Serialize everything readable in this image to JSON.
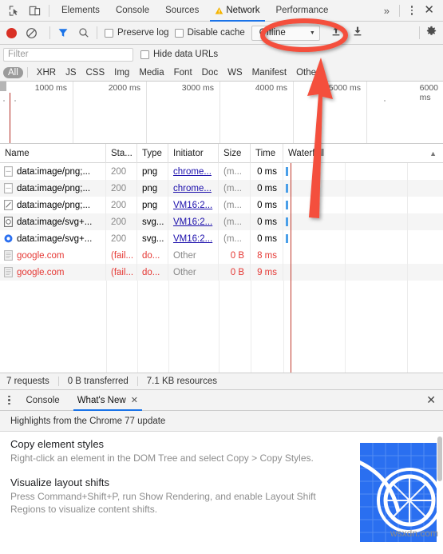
{
  "window": {
    "tabs": [
      {
        "label": "Elements",
        "active": false,
        "warning": false
      },
      {
        "label": "Console",
        "active": false,
        "warning": false
      },
      {
        "label": "Sources",
        "active": false,
        "warning": false
      },
      {
        "label": "Network",
        "active": true,
        "warning": true
      },
      {
        "label": "Performance",
        "active": false,
        "warning": false
      }
    ],
    "more_label": "»",
    "close_label": "✕"
  },
  "toolbar": {
    "record_tooltip": "Record",
    "clear_tooltip": "Clear",
    "preserve_log_label": "Preserve log",
    "disable_cache_label": "Disable cache",
    "throttle_value": "Offline",
    "throttle_caret": "▼",
    "import_tooltip": "Import HAR",
    "export_tooltip": "Export HAR",
    "settings_tooltip": "Settings"
  },
  "filter": {
    "placeholder": "Filter",
    "value": "",
    "hide_data_urls_label": "Hide data URLs",
    "types": [
      {
        "label": "All",
        "selected": true
      },
      {
        "label": "XHR",
        "selected": false
      },
      {
        "label": "JS",
        "selected": false
      },
      {
        "label": "CSS",
        "selected": false
      },
      {
        "label": "Img",
        "selected": false
      },
      {
        "label": "Media",
        "selected": false
      },
      {
        "label": "Font",
        "selected": false
      },
      {
        "label": "Doc",
        "selected": false
      },
      {
        "label": "WS",
        "selected": false
      },
      {
        "label": "Manifest",
        "selected": false
      },
      {
        "label": "Other",
        "selected": false
      }
    ]
  },
  "overview": {
    "ticks": [
      "1000 ms",
      "2000 ms",
      "3000 ms",
      "4000 ms",
      "5000 ms",
      "6000 ms"
    ]
  },
  "table": {
    "columns": [
      "Name",
      "Sta...",
      "Type",
      "Initiator",
      "Size",
      "Time",
      "Waterfall"
    ],
    "sort_indicator": "▲",
    "rows": [
      {
        "icon": "image-file-icon",
        "name": "data:image/png;...",
        "status": "200",
        "type": "png",
        "initiator": "chrome...",
        "initiator_link": true,
        "size": "(m...",
        "time": "0 ms",
        "failed": false
      },
      {
        "icon": "image-file-icon",
        "name": "data:image/png;...",
        "status": "200",
        "type": "png",
        "initiator": "chrome...",
        "initiator_link": true,
        "size": "(m...",
        "time": "0 ms",
        "failed": false
      },
      {
        "icon": "image-file-icon",
        "name": "data:image/png;...",
        "status": "200",
        "type": "png",
        "initiator": "VM16:2...",
        "initiator_link": true,
        "size": "(m...",
        "time": "0 ms",
        "failed": false
      },
      {
        "icon": "svg-file-icon",
        "name": "data:image/svg+...",
        "status": "200",
        "type": "svg...",
        "initiator": "VM16:2...",
        "initiator_link": true,
        "size": "(m...",
        "time": "0 ms",
        "failed": false
      },
      {
        "icon": "svg-file-icon",
        "name": "data:image/svg+...",
        "status": "200",
        "type": "svg...",
        "initiator": "VM16:2...",
        "initiator_link": true,
        "size": "(m...",
        "time": "0 ms",
        "failed": false
      },
      {
        "icon": "document-icon",
        "name": "google.com",
        "status": "(fail...",
        "type": "do...",
        "initiator": "Other",
        "initiator_link": false,
        "size": "0 B",
        "time": "8 ms",
        "failed": true
      },
      {
        "icon": "document-icon",
        "name": "google.com",
        "status": "(fail...",
        "type": "do...",
        "initiator": "Other",
        "initiator_link": false,
        "size": "0 B",
        "time": "9 ms",
        "failed": true
      }
    ]
  },
  "summary": {
    "requests": "7 requests",
    "transferred": "0 B transferred",
    "resources": "7.1 KB resources"
  },
  "drawer": {
    "tabs": [
      {
        "label": "Console",
        "active": false,
        "closable": false
      },
      {
        "label": "What's New",
        "active": true,
        "closable": true
      }
    ],
    "close_label": "✕",
    "tab_close_label": "✕",
    "subtitle": "Highlights from the Chrome 77 update",
    "items": [
      {
        "title": "Copy element styles",
        "description": "Right-click an element in the DOM Tree and select Copy > Copy Styles."
      },
      {
        "title": "Visualize layout shifts",
        "description": "Press Command+Shift+P, run Show Rendering, and enable Layout Shift Regions to visualize content shifts."
      }
    ]
  },
  "watermark": "wsxdn.com",
  "colors": {
    "accent": "#1a73e8",
    "record": "#d93025",
    "annotation": "#f4503c",
    "error": "#e53935",
    "link": "#1a0dab",
    "waterfall_bar": "#4a9fe8"
  }
}
